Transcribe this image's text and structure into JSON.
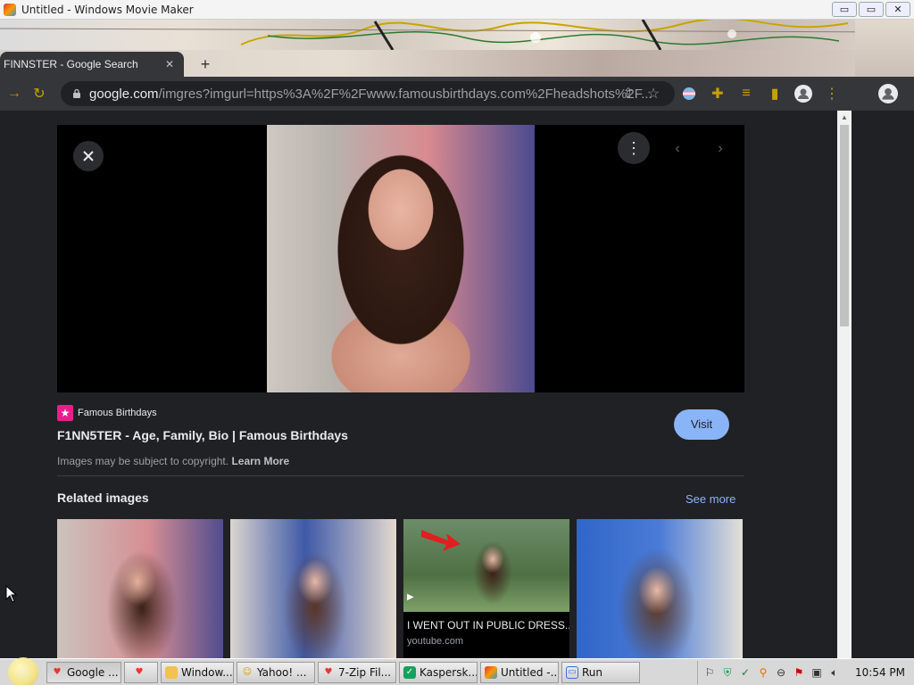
{
  "window": {
    "title": "Untitled - Windows Movie Maker",
    "minimize": "▭",
    "restore": "▭",
    "close": "✕"
  },
  "browser": {
    "tab_title": "FINNSTER - Google Search",
    "url_domain": "google.com",
    "url_path": "/imgres?imgurl=https%3A%2F%2Fwww.famousbirthdays.com%2Fheadshots%2F..."
  },
  "viewer": {
    "source_name": "Famous Birthdays",
    "page_title": "F1NN5TER - Age, Family, Bio | Famous Birthdays",
    "visit_label": "Visit",
    "copyright_text": "Images may be subject to copyright.",
    "learn_more": "Learn More"
  },
  "related": {
    "title": "Related images",
    "see_more": "See more",
    "items": [
      {
        "caption": "",
        "source": ""
      },
      {
        "caption": "",
        "source": ""
      },
      {
        "caption": "I WENT OUT IN PUBLIC DRESS...",
        "source": "youtube.com"
      },
      {
        "caption": "",
        "source": ""
      }
    ]
  },
  "taskbar": {
    "items": [
      {
        "label": "Google ...",
        "icon": "heart-icon",
        "color": "#e53935"
      },
      {
        "label": "",
        "icon": "heart-icon",
        "color": "#e53935"
      },
      {
        "label": "Window...",
        "icon": "folder-icon",
        "color": "#f2c14e"
      },
      {
        "label": "Yahoo! ...",
        "icon": "smiley-icon",
        "color": "#f5c542"
      },
      {
        "label": "7-Zip Fil...",
        "icon": "heart-icon",
        "color": "#e53935"
      },
      {
        "label": "Kaspersk...",
        "icon": "shield-icon",
        "color": "#17a05d"
      },
      {
        "label": "Untitled -...",
        "icon": "movie-maker-icon",
        "color": "#d33"
      },
      {
        "label": "Run",
        "icon": "run-icon",
        "color": "#3a6fd8"
      }
    ],
    "clock": "10:54 PM"
  },
  "colors": {
    "accent": "#8ab4f8",
    "chrome_dark": "#35363a",
    "page_bg": "#202124"
  }
}
